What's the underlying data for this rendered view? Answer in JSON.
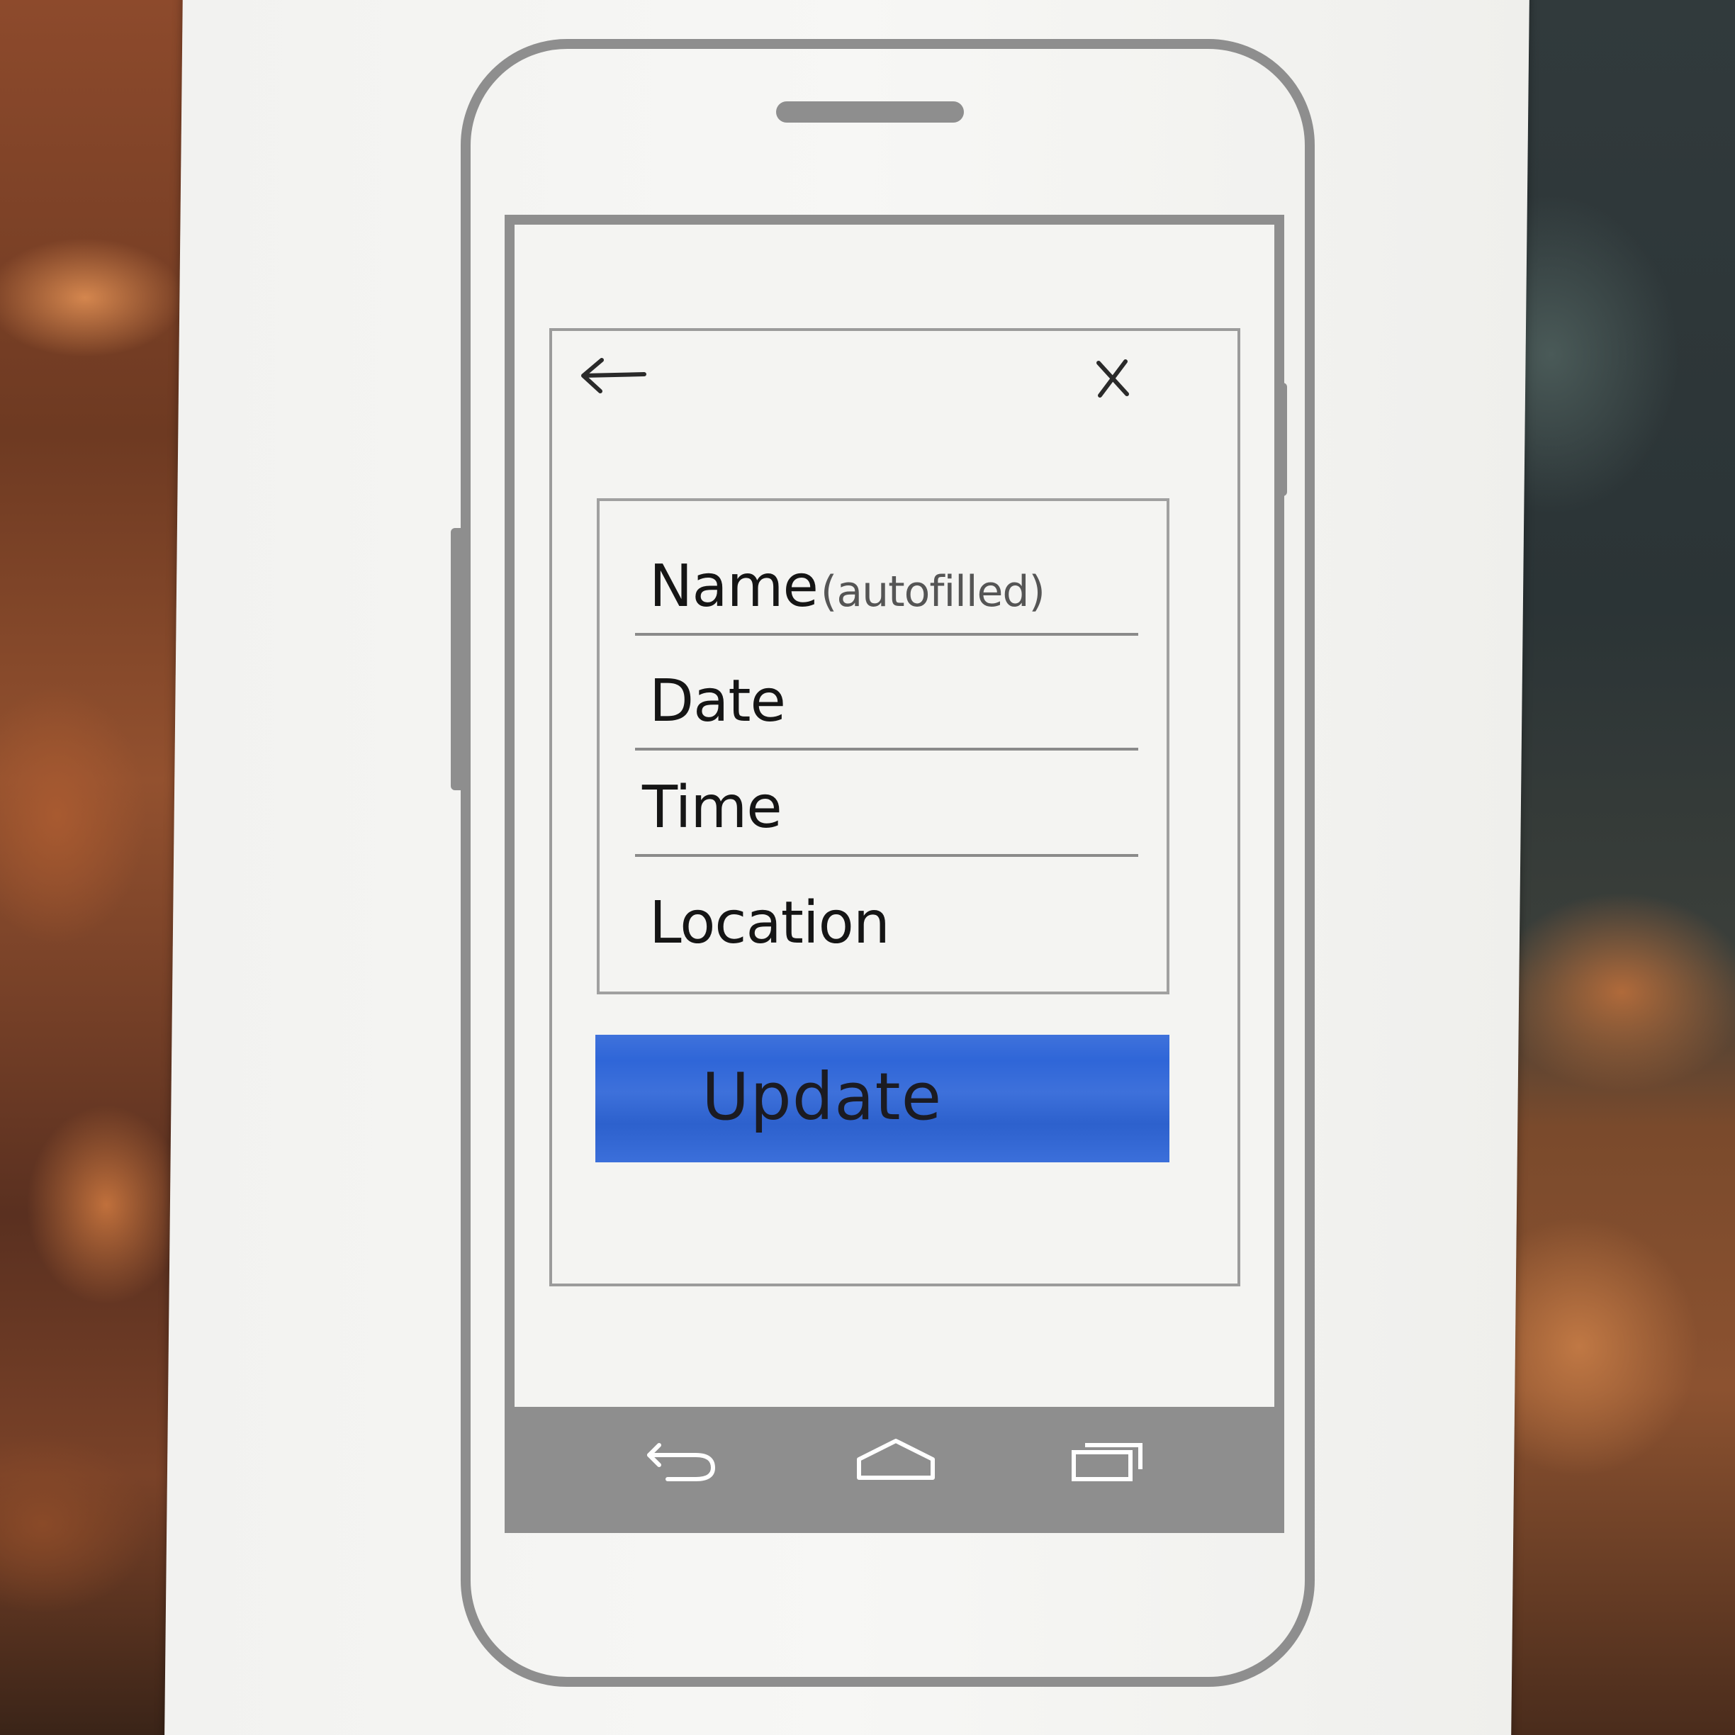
{
  "dialog": {
    "back_icon": "arrow-left-icon",
    "close_icon": "close-icon",
    "fields": [
      {
        "label": "Name",
        "hint": "(autofilled)"
      },
      {
        "label": "Date"
      },
      {
        "label": "Time"
      },
      {
        "label": "Location"
      }
    ],
    "button_label": "Update",
    "button_color": "#2f66d8"
  },
  "navbar": {
    "icons": [
      "back-icon",
      "home-icon",
      "recents-icon"
    ]
  }
}
